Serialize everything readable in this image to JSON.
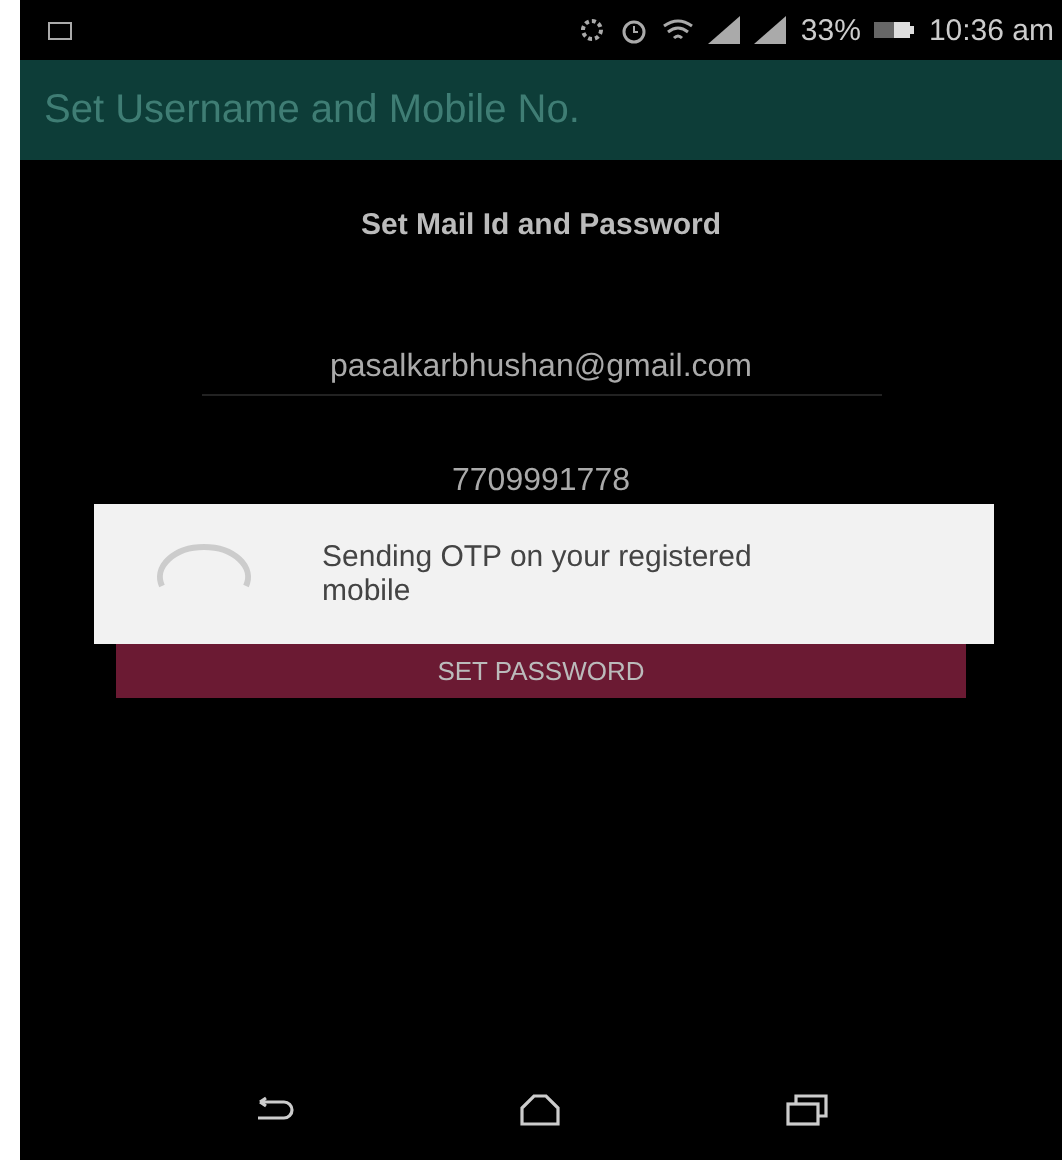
{
  "status_bar": {
    "battery": "33%",
    "time": "10:36 am"
  },
  "app_bar": {
    "title": "Set Username and Mobile No."
  },
  "heading": "Set Mail Id and Password",
  "email_field": {
    "value": "pasalkarbhushan@gmail.com"
  },
  "mobile_field": {
    "value": "7709991778"
  },
  "set_password_button": "SET PASSWORD",
  "progress_dialog": {
    "message": "Sending OTP on your registered mobile"
  }
}
